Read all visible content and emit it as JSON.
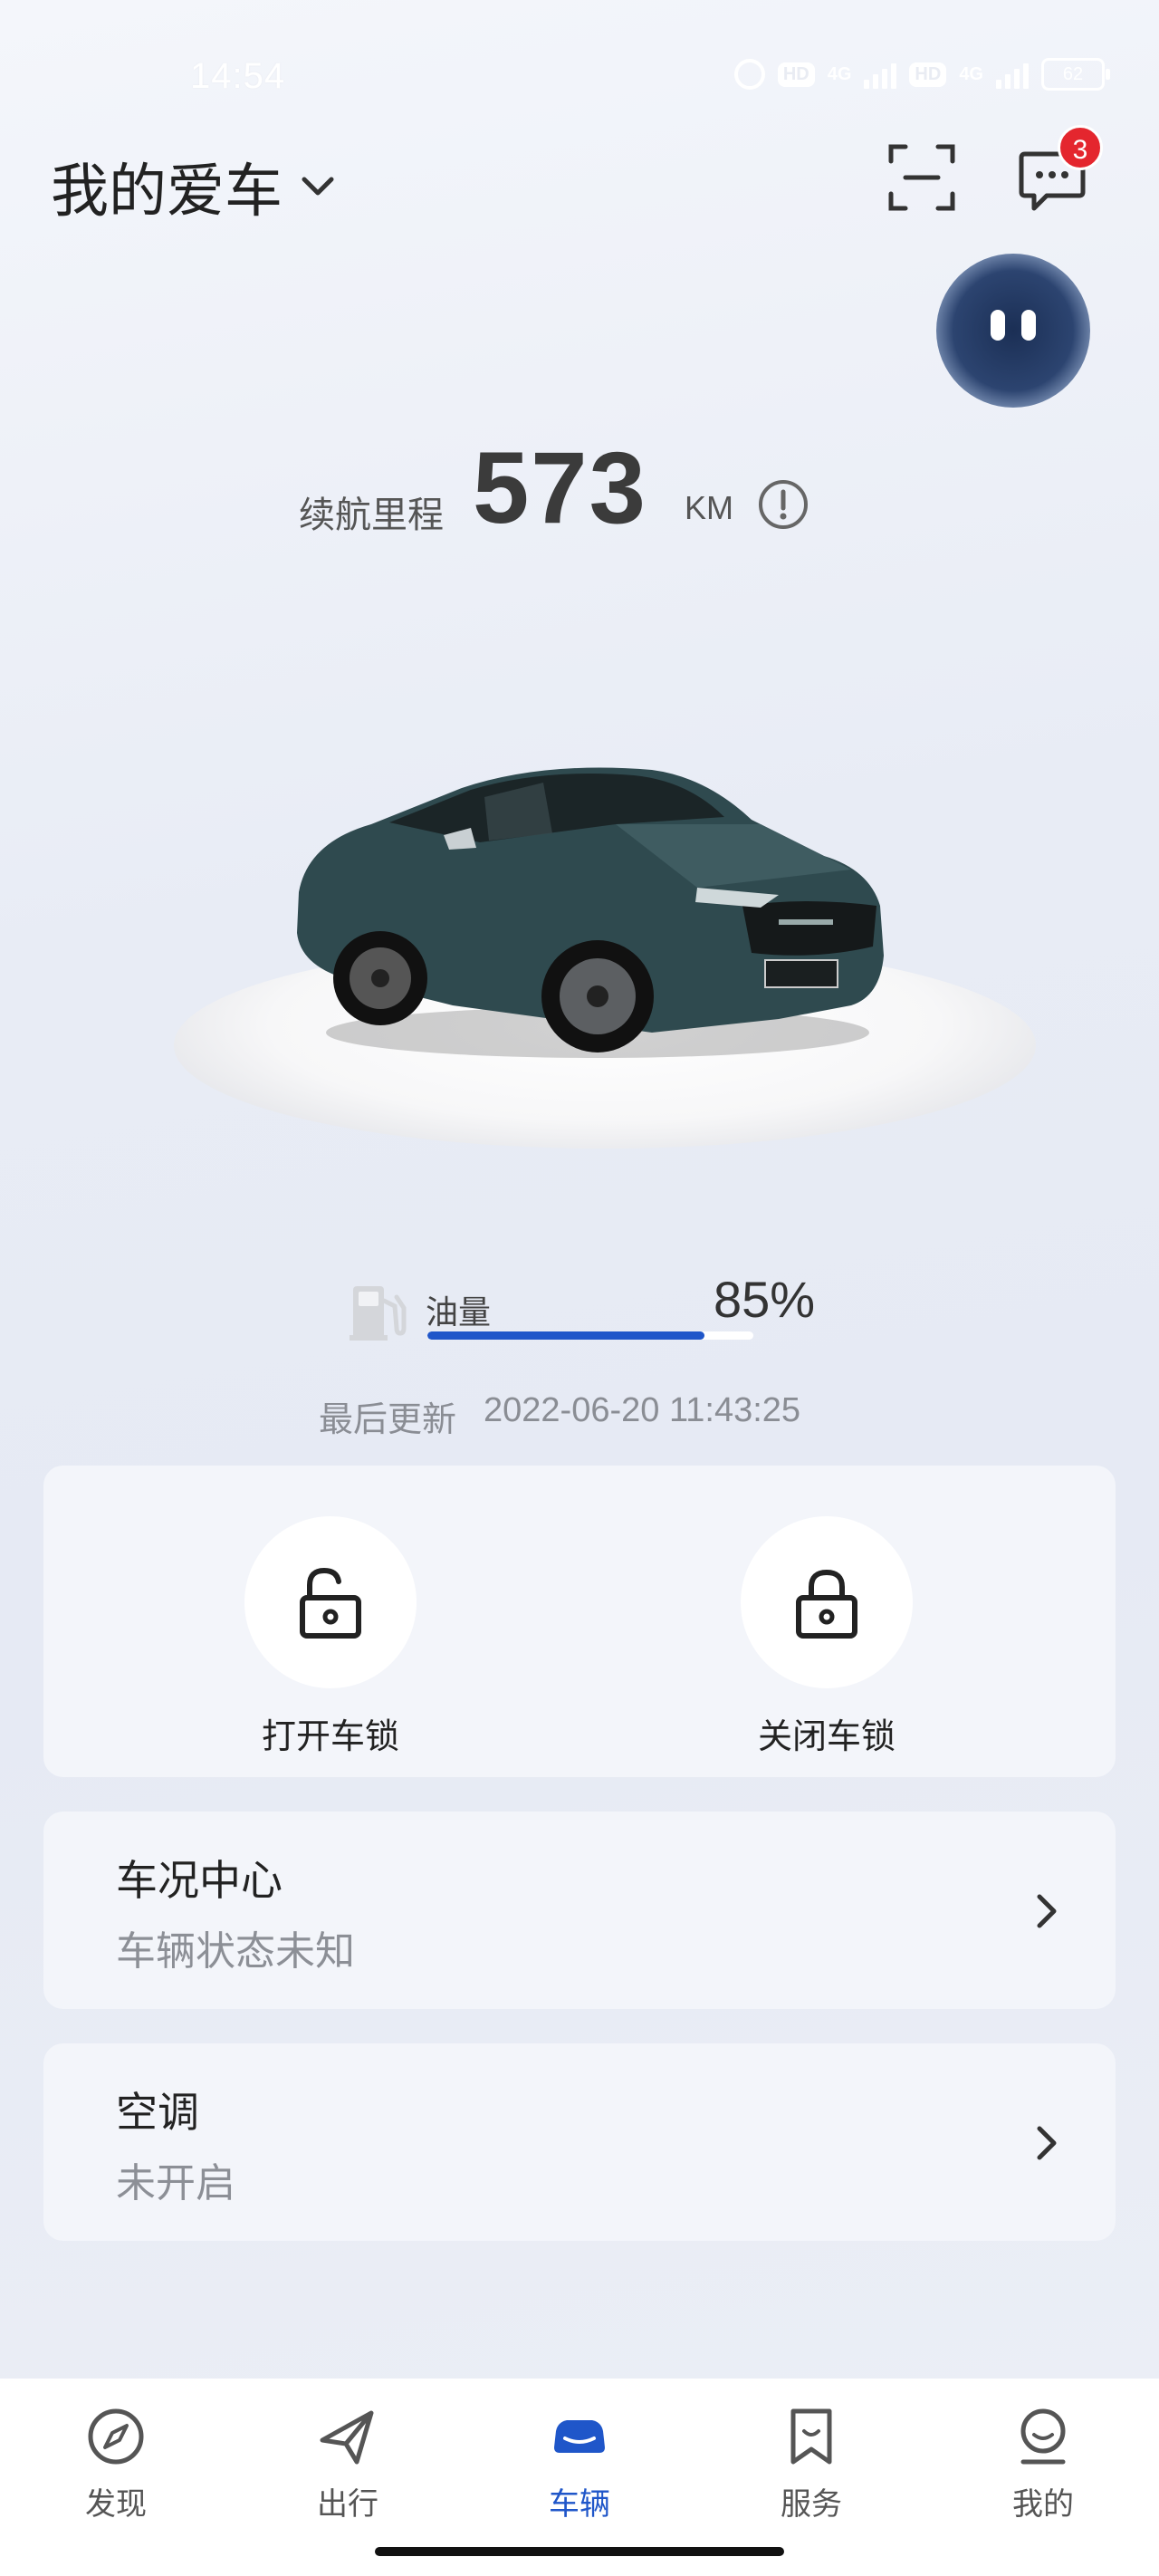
{
  "status_bar": {
    "time": "14:54",
    "hd1": "HD",
    "net1": "4G",
    "hd2": "HD",
    "net2": "4G",
    "battery": "62"
  },
  "header": {
    "title": "我的爱车",
    "message_badge": "3"
  },
  "range": {
    "label": "续航里程",
    "value": "573",
    "unit": "KM"
  },
  "fuel": {
    "label": "油量",
    "percent_text": "85%",
    "level": 0.85
  },
  "update": {
    "label": "最后更新",
    "timestamp": "2022-06-20 11:43:25"
  },
  "lock": {
    "unlock_label": "打开车锁",
    "lock_label": "关闭车锁"
  },
  "rows": {
    "vehicle_status": {
      "title": "车况中心",
      "subtitle": "车辆状态未知"
    },
    "air_con": {
      "title": "空调",
      "subtitle": "未开启"
    }
  },
  "tabs": [
    {
      "label": "发现",
      "icon": "compass-icon"
    },
    {
      "label": "出行",
      "icon": "plane-icon"
    },
    {
      "label": "车辆",
      "icon": "car-icon"
    },
    {
      "label": "服务",
      "icon": "bookmark-icon"
    },
    {
      "label": "我的",
      "icon": "profile-icon"
    }
  ],
  "colors": {
    "accent": "#1f56c9",
    "badge": "#e4262e",
    "car_body": "#2f4a4f"
  }
}
